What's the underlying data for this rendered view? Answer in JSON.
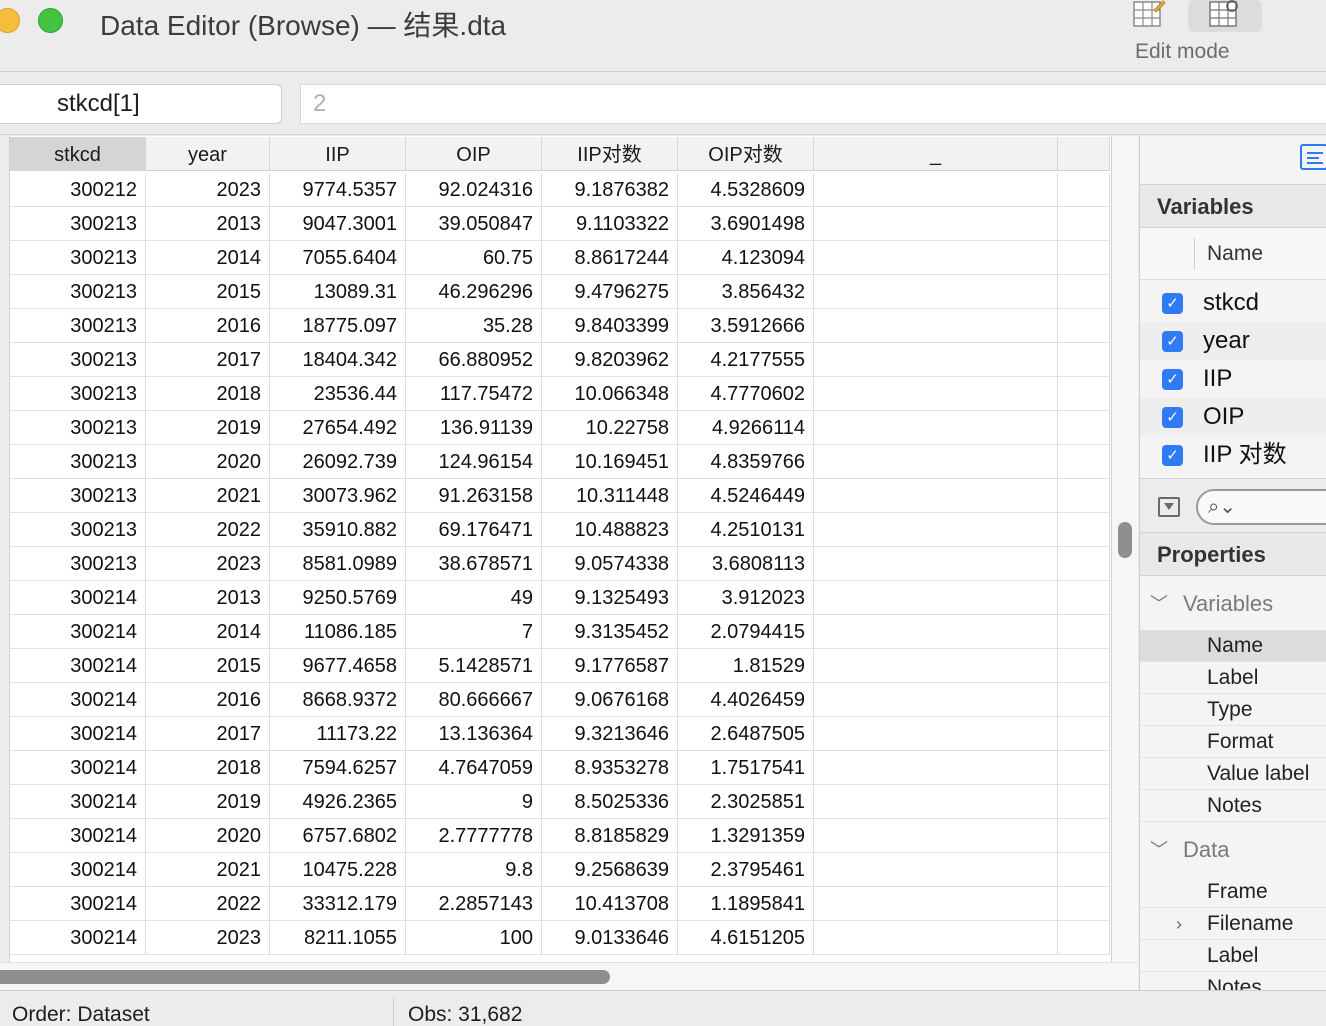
{
  "window": {
    "title": "Data Editor (Browse) — 结果.dta",
    "edit_mode_label": "Edit mode"
  },
  "cellbar": {
    "cell_name": "stkcd[1]",
    "cell_value": "2"
  },
  "grid": {
    "columns": [
      "stkcd",
      "year",
      "IIP",
      "OIP",
      "IIP对数",
      "OIP对数",
      "_",
      ""
    ],
    "rows": [
      [
        "300212",
        "2023",
        "9774.5357",
        "92.024316",
        "9.1876382",
        "4.5328609"
      ],
      [
        "300213",
        "2013",
        "9047.3001",
        "39.050847",
        "9.1103322",
        "3.6901498"
      ],
      [
        "300213",
        "2014",
        "7055.6404",
        "60.75",
        "8.8617244",
        "4.123094"
      ],
      [
        "300213",
        "2015",
        "13089.31",
        "46.296296",
        "9.4796275",
        "3.856432"
      ],
      [
        "300213",
        "2016",
        "18775.097",
        "35.28",
        "9.8403399",
        "3.5912666"
      ],
      [
        "300213",
        "2017",
        "18404.342",
        "66.880952",
        "9.8203962",
        "4.2177555"
      ],
      [
        "300213",
        "2018",
        "23536.44",
        "117.75472",
        "10.066348",
        "4.7770602"
      ],
      [
        "300213",
        "2019",
        "27654.492",
        "136.91139",
        "10.22758",
        "4.9266114"
      ],
      [
        "300213",
        "2020",
        "26092.739",
        "124.96154",
        "10.169451",
        "4.8359766"
      ],
      [
        "300213",
        "2021",
        "30073.962",
        "91.263158",
        "10.311448",
        "4.5246449"
      ],
      [
        "300213",
        "2022",
        "35910.882",
        "69.176471",
        "10.488823",
        "4.2510131"
      ],
      [
        "300213",
        "2023",
        "8581.0989",
        "38.678571",
        "9.0574338",
        "3.6808113"
      ],
      [
        "300214",
        "2013",
        "9250.5769",
        "49",
        "9.1325493",
        "3.912023"
      ],
      [
        "300214",
        "2014",
        "11086.185",
        "7",
        "9.3135452",
        "2.0794415"
      ],
      [
        "300214",
        "2015",
        "9677.4658",
        "5.1428571",
        "9.1776587",
        "1.81529"
      ],
      [
        "300214",
        "2016",
        "8668.9372",
        "80.666667",
        "9.0676168",
        "4.4026459"
      ],
      [
        "300214",
        "2017",
        "11173.22",
        "13.136364",
        "9.3213646",
        "2.6487505"
      ],
      [
        "300214",
        "2018",
        "7594.6257",
        "4.7647059",
        "8.9353278",
        "1.7517541"
      ],
      [
        "300214",
        "2019",
        "4926.2365",
        "9",
        "8.5025336",
        "2.3025851"
      ],
      [
        "300214",
        "2020",
        "6757.6802",
        "2.7777778",
        "8.8185829",
        "1.3291359"
      ],
      [
        "300214",
        "2021",
        "10475.228",
        "9.8",
        "9.2568639",
        "2.3795461"
      ],
      [
        "300214",
        "2022",
        "33312.179",
        "2.2857143",
        "10.413708",
        "1.1895841"
      ],
      [
        "300214",
        "2023",
        "8211.1055",
        "100",
        "9.0133646",
        "4.6151205"
      ]
    ]
  },
  "status": {
    "order": "Order: Dataset",
    "obs": "Obs: 31,682"
  },
  "panel": {
    "variables_title": "Variables",
    "name_header": "Name",
    "variables": [
      "stkcd",
      "year",
      "IIP",
      "OIP",
      "IIP 对数"
    ],
    "properties_title": "Properties",
    "prop_variables_group": "Variables",
    "prop_variables_items": [
      "Name",
      "Label",
      "Type",
      "Format",
      "Value label",
      "Notes"
    ],
    "prop_data_group": "Data",
    "prop_data_items": [
      "Frame",
      "Filename",
      "Label",
      "Notes"
    ]
  },
  "colors": {
    "accent": "#2f7bf5",
    "selected_header": "#d5d5d5"
  }
}
